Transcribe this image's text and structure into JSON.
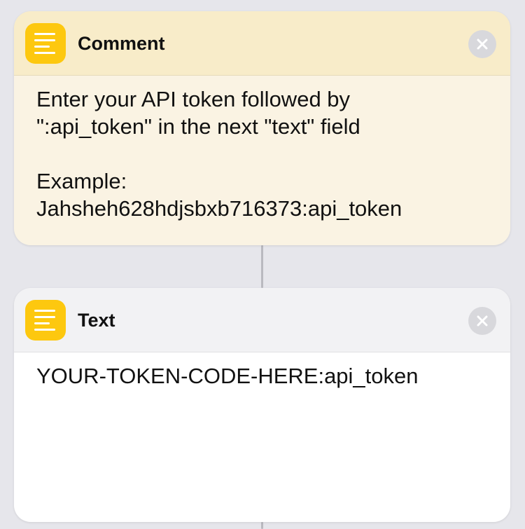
{
  "comment_card": {
    "title": "Comment",
    "icon": "text-lines-icon",
    "lines": [
      "Enter your API token followed by",
      "\":api_token\" in the next \"text\" field",
      "",
      "Example:",
      "Jahsheh628hdjsbxb716373:api_token"
    ]
  },
  "text_card": {
    "title": "Text",
    "icon": "text-lines-icon",
    "value": "YOUR-TOKEN-CODE-HERE:api_token"
  },
  "colors": {
    "background": "#e6e6eb",
    "icon_yellow": "#fdc80f",
    "comment_header": "#f8ecc9",
    "comment_body": "#faf3e3",
    "text_header": "#f2f2f4",
    "text_body": "#ffffff"
  }
}
